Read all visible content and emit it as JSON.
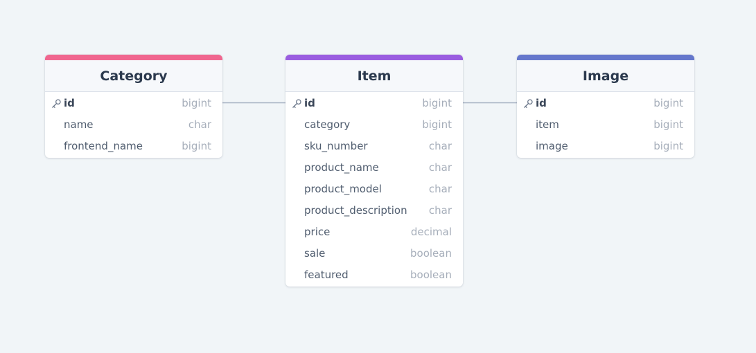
{
  "tables": [
    {
      "id": "category",
      "title": "Category",
      "accent": "#f0668f",
      "fields": [
        {
          "name": "id",
          "type": "bigint",
          "pk": true
        },
        {
          "name": "name",
          "type": "char",
          "pk": false
        },
        {
          "name": "frontend_name",
          "type": "bigint",
          "pk": false
        }
      ]
    },
    {
      "id": "item",
      "title": "Item",
      "accent": "#9a5de0",
      "fields": [
        {
          "name": "id",
          "type": "bigint",
          "pk": true
        },
        {
          "name": "category",
          "type": "bigint",
          "pk": false
        },
        {
          "name": "sku_number",
          "type": "char",
          "pk": false
        },
        {
          "name": "product_name",
          "type": "char",
          "pk": false
        },
        {
          "name": "product_model",
          "type": "char",
          "pk": false
        },
        {
          "name": "product_description",
          "type": "char",
          "pk": false
        },
        {
          "name": "price",
          "type": "decimal",
          "pk": false
        },
        {
          "name": "sale",
          "type": "boolean",
          "pk": false
        },
        {
          "name": "featured",
          "type": "boolean",
          "pk": false
        }
      ]
    },
    {
      "id": "image",
      "title": "Image",
      "accent": "#6577cc",
      "fields": [
        {
          "name": "id",
          "type": "bigint",
          "pk": true
        },
        {
          "name": "item",
          "type": "bigint",
          "pk": false
        },
        {
          "name": "image",
          "type": "bigint",
          "pk": false
        }
      ]
    }
  ],
  "relationships": [
    {
      "from": "category.id",
      "to": "item.id"
    },
    {
      "from": "item.id",
      "to": "image.id"
    }
  ],
  "colors": {
    "background": "#f1f5f8",
    "connector": "#a5b0c2"
  },
  "icons": {
    "primary_key": "key-icon"
  }
}
